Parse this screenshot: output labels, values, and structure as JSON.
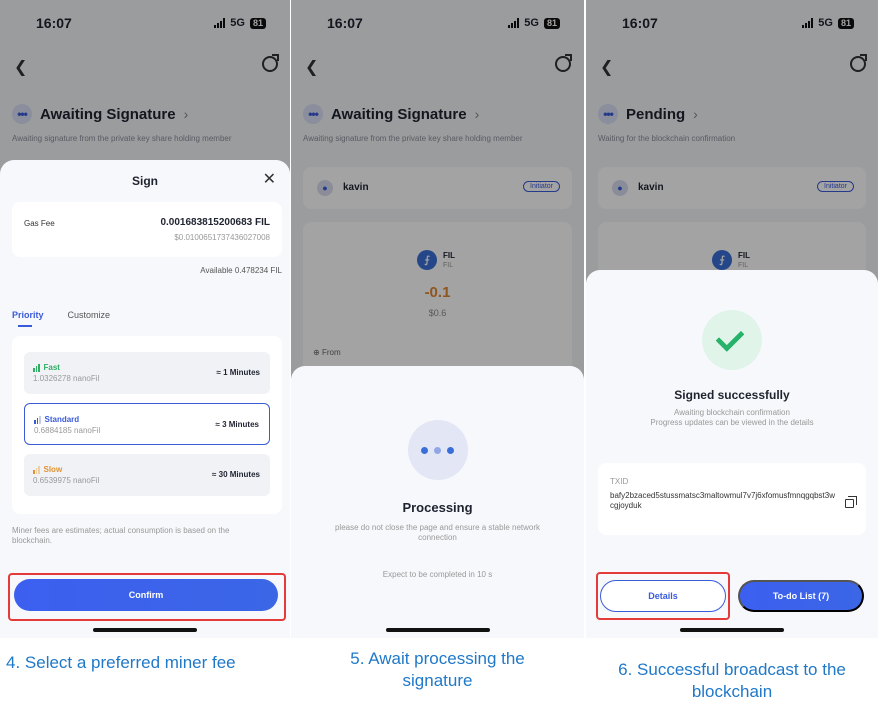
{
  "status": {
    "time": "16:07",
    "network": "5G",
    "battery": "81"
  },
  "icons": {
    "back": "chevron-left-icon",
    "refresh": "refresh-icon",
    "close": "close-icon",
    "copy": "copy-icon",
    "member": "user-icon",
    "coin": "fil-coin-icon"
  },
  "colors": {
    "accent": "#3a5bd9",
    "highlight_frame": "#e53a3a",
    "amount": "#e3852f",
    "success": "#26b269",
    "caption": "#1f78c8"
  },
  "screens": [
    {
      "state_title": "Awaiting Signature",
      "state_sub": "Awaiting signature from the private key share holding member",
      "sheet": {
        "title": "Sign",
        "gas_fee_label": "Gas Fee",
        "gas_fee_value": "0.001683815200683 FIL",
        "gas_fee_usd": "$0.0100651737436027008",
        "available": "Available 0.478234 FIL",
        "tabs": [
          "Priority",
          "Customize"
        ],
        "fees": [
          {
            "name": "Fast",
            "rate": "1.0326278 nanoFil",
            "time": "≈ 1 Minutes",
            "color": "#2fae63"
          },
          {
            "name": "Standard",
            "rate": "0.6884185 nanoFil",
            "time": "≈ 3 Minutes",
            "color": "#3a5bd9"
          },
          {
            "name": "Slow",
            "rate": "0.6539975 nanoFil",
            "time": "≈ 30 Minutes",
            "color": "#e3932f"
          }
        ],
        "note": "Miner fees are estimates; actual consumption is based on the blockchain.",
        "confirm": "Confirm"
      },
      "caption": "4. Select a preferred miner fee"
    },
    {
      "state_title": "Awaiting Signature",
      "state_sub": "Awaiting signature from the private key share holding member",
      "member": "kavin",
      "initiator": "Initiator",
      "coin_name": "FIL",
      "coin_sub": "FIL",
      "amount": "-0.1",
      "amount_usd": "$0.6",
      "from": "From",
      "sheet": {
        "title": "Processing",
        "note": "please do not close the page and ensure a stable network connection",
        "expect": "Expect to be completed in 10 s"
      },
      "caption_line1": "5. Await processing the",
      "caption_line2": "signature"
    },
    {
      "state_title": "Pending",
      "state_sub": "Waiting for the blockchain confirmation",
      "member": "kavin",
      "initiator": "Initiator",
      "coin_name": "FIL",
      "coin_sub": "FIL",
      "sheet": {
        "title": "Signed successfully",
        "sub1": "Awaiting blockchain confirmation",
        "sub2": "Progress updates can be viewed in the details",
        "txid_label": "TXID",
        "txid": "bafy2bzaced5stussmatsc3maltowmul7v7j6xfomusfmnqgqbst3wcgjoyduk",
        "details": "Details",
        "todo": "To-do List (7)"
      },
      "caption_line1": "6. Successful broadcast to the",
      "caption_line2": "blockchain"
    }
  ]
}
